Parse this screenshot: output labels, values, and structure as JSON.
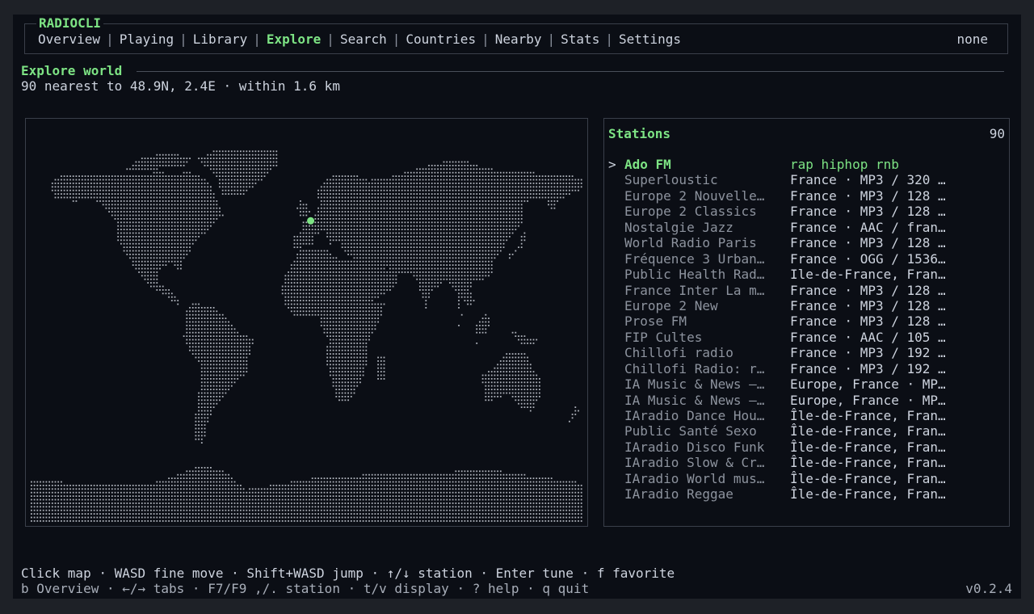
{
  "app": {
    "title": "RADIOCLI",
    "version": "v0.2.4"
  },
  "tabs": [
    {
      "label": "Overview"
    },
    {
      "label": "Playing"
    },
    {
      "label": "Library"
    },
    {
      "label": "Explore",
      "active": true
    },
    {
      "label": "Search"
    },
    {
      "label": "Countries"
    },
    {
      "label": "Nearby"
    },
    {
      "label": "Stats"
    },
    {
      "label": "Settings"
    }
  ],
  "tab_right": "none",
  "explore": {
    "title": "Explore world",
    "subtitle": "90 nearest to 48.9N, 2.4E · within 1.6 km"
  },
  "map": {
    "marker": {
      "lat": 48.9,
      "lon": 2.4
    },
    "marker_color": "#7de384",
    "land_color": "#c9cdd6"
  },
  "stations": {
    "title": "Stations",
    "count": "90",
    "selected_marker": ">",
    "items": [
      {
        "name": "Ado FM",
        "meta": "rap hiphop rnb",
        "selected": true
      },
      {
        "name": "Superloustic",
        "meta": "France · MP3 / 320 …"
      },
      {
        "name": "Europe 2 Nouvelle…",
        "meta": "France · MP3 / 128 …"
      },
      {
        "name": "Europe 2 Classics",
        "meta": "France · MP3 / 128 …"
      },
      {
        "name": "Nostalgie Jazz",
        "meta": "France · AAC / fran…"
      },
      {
        "name": "World Radio Paris",
        "meta": "France · MP3 / 128 …"
      },
      {
        "name": "Fréquence 3 Urban…",
        "meta": "France · OGG / 1536…"
      },
      {
        "name": "Public Health Rad…",
        "meta": "Ile-de-France, Fran…"
      },
      {
        "name": "France Inter La m…",
        "meta": "France · MP3 / 128 …"
      },
      {
        "name": "Europe 2 New",
        "meta": "France · MP3 / 128 …"
      },
      {
        "name": "Prose FM",
        "meta": "France · MP3 / 128 …"
      },
      {
        "name": "FIP Cultes",
        "meta": "France · AAC / 105 …"
      },
      {
        "name": "Chillofi radio",
        "meta": "France · MP3 / 192 …"
      },
      {
        "name": "Chillofi Radio: r…",
        "meta": "France · MP3 / 192 …"
      },
      {
        "name": "IA Music & News –…",
        "meta": "Europe, France · MP…"
      },
      {
        "name": "IA Music & News –…",
        "meta": "Europe, France · MP…"
      },
      {
        "name": "IAradio Dance Hou…",
        "meta": "Île-de-France, Fran…"
      },
      {
        "name": "Public Santé Sexo",
        "meta": "Île-de-France, Fran…"
      },
      {
        "name": "IAradio Disco Funk",
        "meta": "Île-de-France, Fran…"
      },
      {
        "name": "IAradio Slow & Cr…",
        "meta": "Île-de-France, Fran…"
      },
      {
        "name": "IAradio World mus…",
        "meta": "Île-de-France, Fran…"
      },
      {
        "name": "IAradio Reggae",
        "meta": "Île-de-France, Fran…"
      }
    ]
  },
  "help": {
    "line1": "Click map · WASD fine move · Shift+WASD jump · ↑/↓ station · Enter tune · f favorite",
    "line2": "b Overview · ←/→ tabs · F7/F9 ,/. station · t/v display · ? help · q quit"
  }
}
